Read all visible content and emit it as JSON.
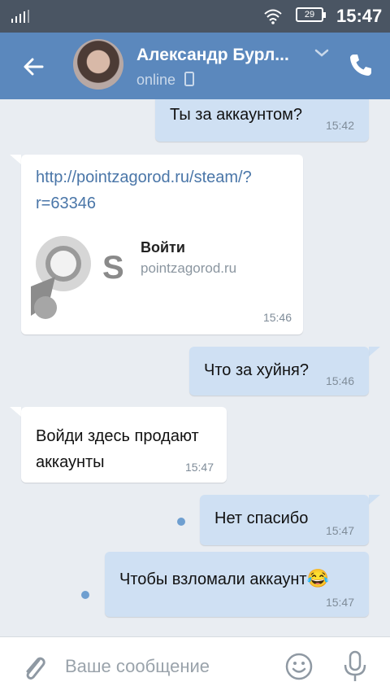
{
  "status_bar": {
    "time": "15:47",
    "battery": "29"
  },
  "header": {
    "contact_name": "Александр Бурл...",
    "presence": "online"
  },
  "messages": [
    {
      "direction": "out",
      "text": "Ты за аккаунтом?",
      "time": "15:42"
    },
    {
      "direction": "in",
      "link": "http://pointzagorod.ru/steam/?r=63346",
      "link_line1": "http://pointzagorod.ru/steam/?",
      "link_line2": "r=63346",
      "preview_title": "Войти",
      "preview_domain": "pointzagorod.ru",
      "time": "15:46"
    },
    {
      "direction": "out",
      "text": "Что за хуйня?",
      "time": "15:46"
    },
    {
      "direction": "in",
      "text_line1": "Войди здесь продают",
      "text_line2": "аккаунты",
      "time": "15:47"
    },
    {
      "direction": "out",
      "text": "Нет спасибо",
      "time": "15:47",
      "unread": true
    },
    {
      "direction": "out",
      "text": "Чтобы взломали аккаунт",
      "emoji": "😂",
      "time": "15:47",
      "unread": true
    }
  ],
  "composer": {
    "placeholder": "Ваше сообщение"
  },
  "colors": {
    "header": "#5b88bd",
    "status_bar": "#4a5563",
    "outgoing": "#cfe0f3",
    "incoming": "#ffffff",
    "link": "#4a76a8"
  },
  "icons": [
    "signal-icon",
    "wifi-icon",
    "battery-icon",
    "back-arrow-icon",
    "chevron-down-icon",
    "phone-icon",
    "mobile-device-icon",
    "paperclip-icon",
    "smile-icon",
    "microphone-icon"
  ]
}
